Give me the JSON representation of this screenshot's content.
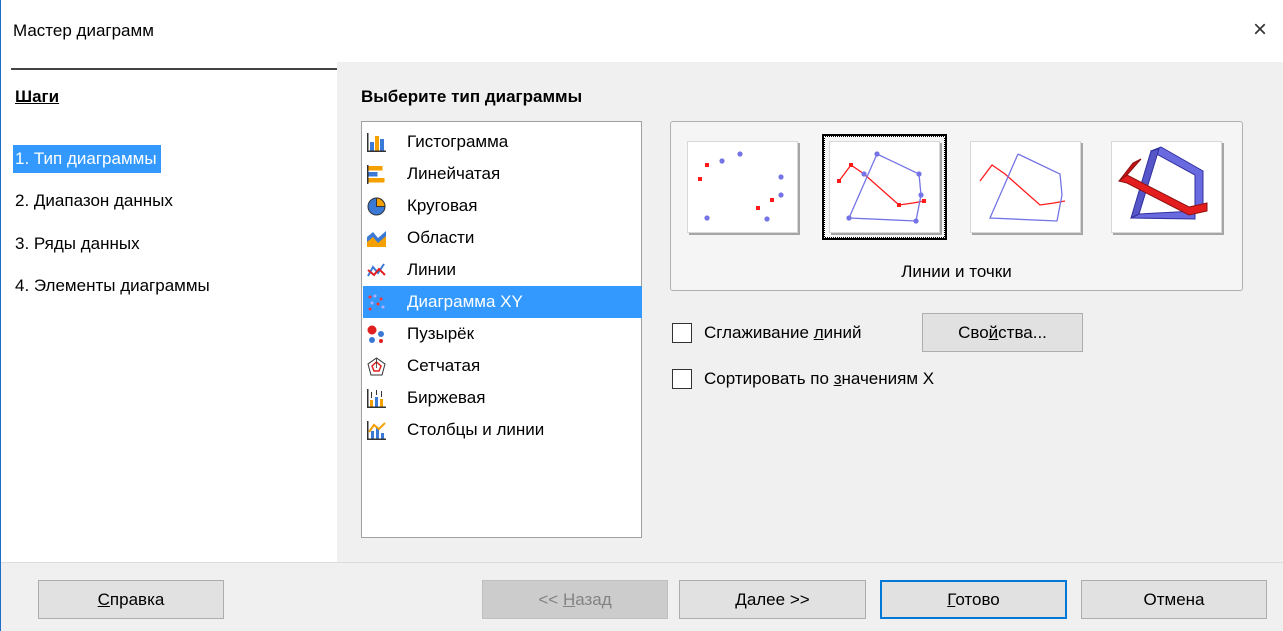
{
  "window": {
    "title": "Мастер диаграмм",
    "close_glyph": "×"
  },
  "steps": {
    "heading": "Шаги",
    "items": [
      {
        "label": "1. Тип диаграммы",
        "active": true
      },
      {
        "label": "2. Диапазон данных",
        "active": false
      },
      {
        "label": "3. Ряды данных",
        "active": false
      },
      {
        "label": "4. Элементы диаграммы",
        "active": false
      }
    ]
  },
  "main": {
    "section_title": "Выберите тип диаграммы",
    "chart_types": [
      {
        "label": "Гистограмма",
        "icon": "column-chart-icon",
        "selected": false
      },
      {
        "label": "Линейчатая",
        "icon": "bar-chart-icon",
        "selected": false
      },
      {
        "label": "Круговая",
        "icon": "pie-chart-icon",
        "selected": false
      },
      {
        "label": "Области",
        "icon": "area-chart-icon",
        "selected": false
      },
      {
        "label": "Линии",
        "icon": "line-chart-icon",
        "selected": false
      },
      {
        "label": "Диаграмма XY",
        "icon": "xy-scatter-chart-icon",
        "selected": true
      },
      {
        "label": "Пузырёк",
        "icon": "bubble-chart-icon",
        "selected": false
      },
      {
        "label": "Сетчатая",
        "icon": "net-chart-icon",
        "selected": false
      },
      {
        "label": "Биржевая",
        "icon": "stock-chart-icon",
        "selected": false
      },
      {
        "label": "Столбцы и линии",
        "icon": "column-and-line-chart-icon",
        "selected": false
      }
    ],
    "variants": {
      "items": [
        {
          "name": "points-only",
          "selected": false
        },
        {
          "name": "points-and-lines",
          "selected": true
        },
        {
          "name": "lines-only",
          "selected": false
        },
        {
          "name": "3d-lines",
          "selected": false
        }
      ],
      "caption": "Линии и точки"
    },
    "smooth_lines": {
      "label_pre": "Сглаживание ",
      "label_u": "л",
      "label_post": "иний",
      "checked": false
    },
    "properties_button": {
      "label_pre": "Сво",
      "label_u": "й",
      "label_post": "ства..."
    },
    "sort_by_x": {
      "label_pre": "Сортировать по ",
      "label_u": "з",
      "label_post": "начениям X",
      "checked": false
    }
  },
  "footer": {
    "help": {
      "label_u": "С",
      "label_post": "правка"
    },
    "back": {
      "label_pre": "<< ",
      "label_u": "Н",
      "label_post": "азад",
      "disabled": true
    },
    "next": {
      "label_u": "Д",
      "label_post": "алее >>"
    },
    "finish": {
      "label_u": "Г",
      "label_post": "отово"
    },
    "cancel": {
      "label": "Отмена"
    }
  },
  "colors": {
    "accent": "#3399ff",
    "default_button_border": "#0078d7",
    "series_red": "#ff0000",
    "series_blue": "#7070e0"
  }
}
